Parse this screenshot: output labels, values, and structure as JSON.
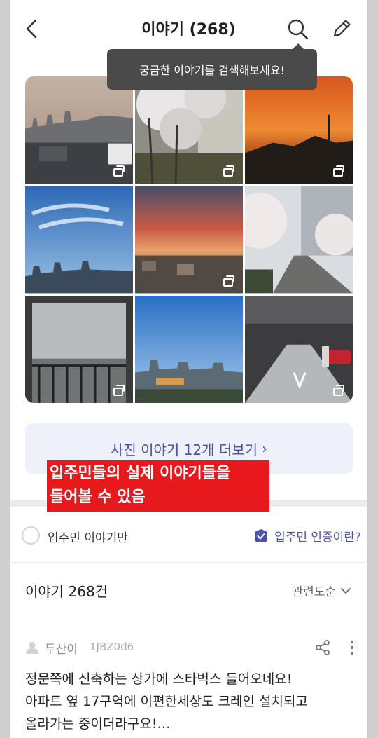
{
  "header": {
    "title": "이야기 (268)"
  },
  "tooltip": {
    "text": "궁금한 이야기를 검색해보세요!"
  },
  "photos": {
    "more_label": "사진 이야기 12개 더보기",
    "more_chevron": "›"
  },
  "annotation": {
    "line1": "입주민들의 실제 이야기들을",
    "line2": "들어볼 수 있음"
  },
  "filter": {
    "resident_only_label": "입주민 이야기만",
    "verify_label": "입주민 인증이란?"
  },
  "list": {
    "count_label": "이야기 268건",
    "sort_label": "관련도순"
  },
  "post": {
    "author": "두산이",
    "user_id": "1JBZ0d6",
    "lines": [
      "정문쪽에 신축하는 상가에 스타벅스 들어오네요!",
      "아파트 옆 17구역에 이편한세상도 크레인 설치되고",
      "올라가는 중이더라구요!…"
    ]
  },
  "colors": {
    "accent": "#4a4fb0",
    "annotation_bg": "#e8191d",
    "more_bg": "#eef0fa"
  }
}
